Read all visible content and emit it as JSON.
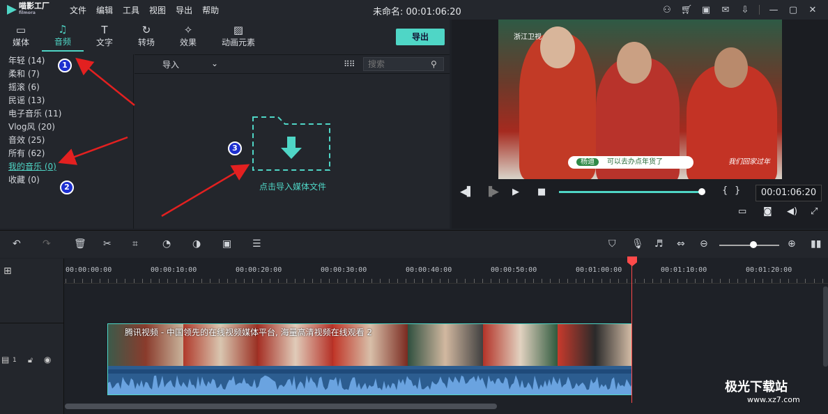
{
  "app": {
    "logo_text": "喵影工厂",
    "logo_sub": "filmora",
    "doc_title": "未命名: 00:01:06:20"
  },
  "menu": [
    "文件",
    "编辑",
    "工具",
    "视图",
    "导出",
    "帮助"
  ],
  "tabs": [
    {
      "label": "媒体",
      "icon": "folder-icon",
      "glyph": "▭"
    },
    {
      "label": "音频",
      "icon": "music-icon",
      "glyph": "♫"
    },
    {
      "label": "文字",
      "icon": "text-icon",
      "glyph": "T"
    },
    {
      "label": "转场",
      "icon": "transition-icon",
      "glyph": "↻"
    },
    {
      "label": "效果",
      "icon": "effects-icon",
      "glyph": "✧"
    },
    {
      "label": "动画元素",
      "icon": "image-icon",
      "glyph": "▨"
    }
  ],
  "export_label": "导出",
  "categories": [
    "年轻 (14)",
    "柔和 (7)",
    "摇滚 (6)",
    "民谣 (13)",
    "电子音乐 (11)",
    "Vlog风 (20)",
    "音效 (25)",
    "所有 (62)",
    "我的音乐 (0)",
    "收藏 (0)"
  ],
  "media": {
    "import_label": "导入",
    "search_placeholder": "搜索",
    "drop_label": "点击导入媒体文件"
  },
  "player": {
    "timecode": "00:01:06:20",
    "progress": 0.98
  },
  "ruler": [
    "00:00:00:00",
    "00:00:10:00",
    "00:00:20:00",
    "00:00:30:00",
    "00:00:40:00",
    "00:00:50:00",
    "00:01:00:00",
    "00:01:10:00",
    "00:01:20:00"
  ],
  "clip": {
    "title": "腾讯视频 - 中国领先的在线视频媒体平台, 海量高清视频在线观看 2"
  },
  "track": {
    "number": "1"
  },
  "video_overlay": {
    "channel": "浙江卫视",
    "name": "杨迪",
    "caption": "可以去办点年货了",
    "show": "我们回家过年"
  },
  "annotations": [
    "1",
    "2",
    "3"
  ],
  "watermark": {
    "text": "极光下载站",
    "url": "www.xz7.com"
  },
  "colors": {
    "accent": "#4fd6c6",
    "playhead": "#ff4a4a",
    "arrow": "#e32020"
  }
}
